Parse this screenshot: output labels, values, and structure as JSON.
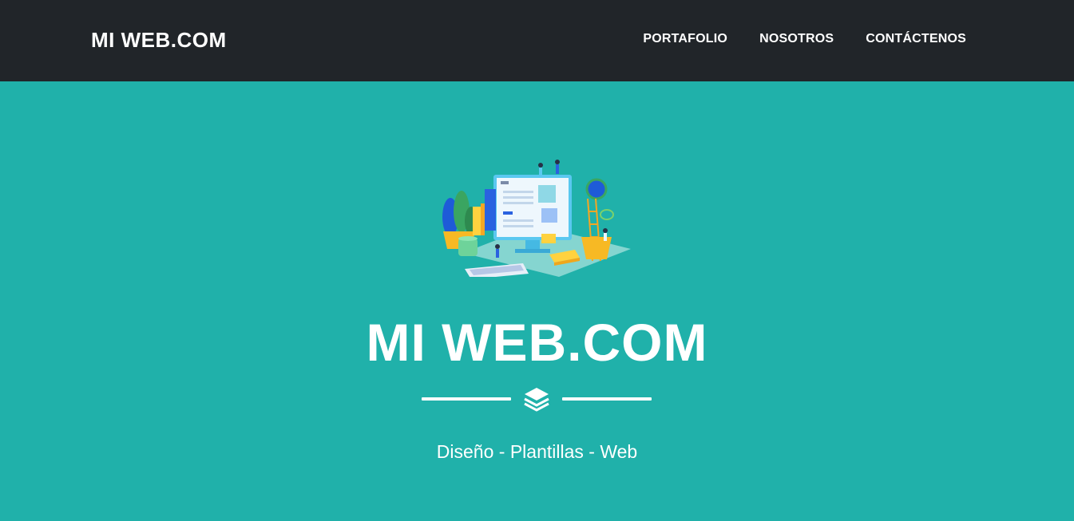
{
  "navbar": {
    "brand": "MI WEB.COM",
    "links": [
      {
        "label": "PORTAFOLIO"
      },
      {
        "label": "NOSOTROS"
      },
      {
        "label": "CONTÁCTENOS"
      }
    ]
  },
  "masthead": {
    "title": "MI WEB.COM",
    "divider_icon": "layers-icon",
    "subtitle": "Diseño - Plantillas - Web"
  },
  "colors": {
    "navbar_bg": "#212529",
    "hero_bg": "#20b1aa",
    "text": "#ffffff"
  }
}
